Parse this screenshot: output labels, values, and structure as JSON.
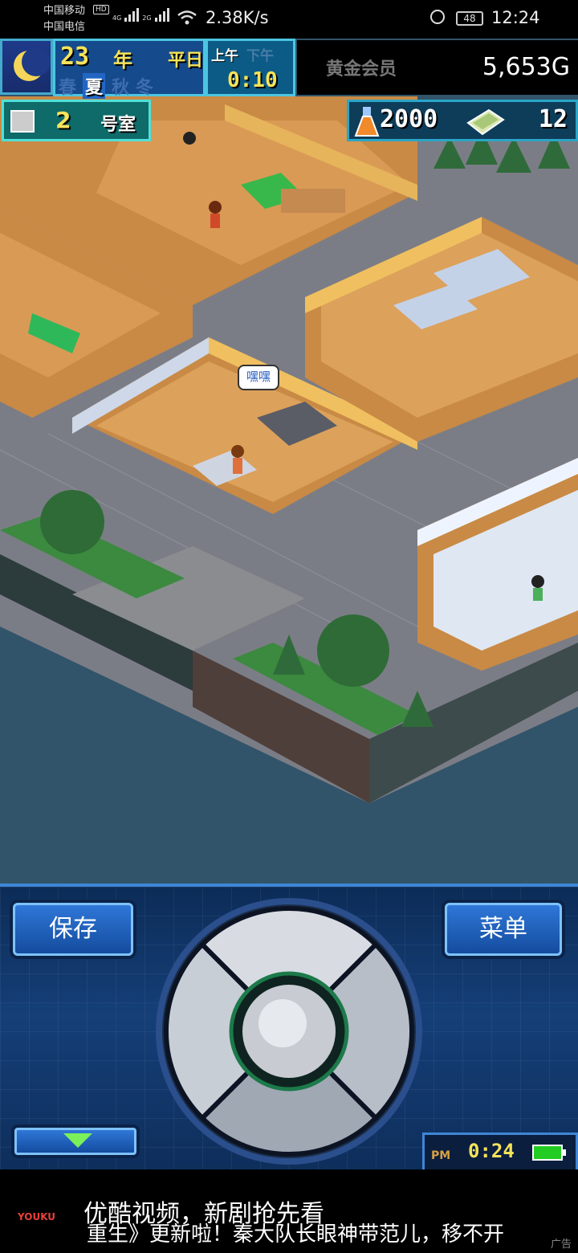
{
  "status_bar": {
    "carrier1": "中国移动",
    "carrier2": "中国电信",
    "hd": "HD",
    "net1": "4G",
    "net2": "2G",
    "speed": "2.38K/s",
    "battery": "48",
    "time": "12:24"
  },
  "hud": {
    "year_number": "23",
    "year_unit": "年",
    "weekday": "平日",
    "seasons": [
      "春",
      "夏",
      "秋",
      "冬"
    ],
    "active_season": "夏",
    "am": "上午",
    "pm": "下午",
    "time": "0:10",
    "member": "黄金会员",
    "money": "5,653G",
    "room_number": "2",
    "room_label": "号室",
    "research_points": "2000",
    "tickets": "12"
  },
  "game_view": {
    "speech_bubble": "嘿嘿"
  },
  "controls": {
    "save_label": "保存",
    "menu_label": "菜单",
    "pm_label": "PM",
    "game_time": "0:24"
  },
  "ad": {
    "brand": "YOUKU",
    "title": "优酷视频，新剧抢先看",
    "subtitle": "重生》更新啦！秦大队长眼神带范儿，移不开",
    "mark": "广告"
  },
  "colors": {
    "hud_yellow": "#f5e35a",
    "panel_blue": "#153f78",
    "water": "#32546a"
  }
}
